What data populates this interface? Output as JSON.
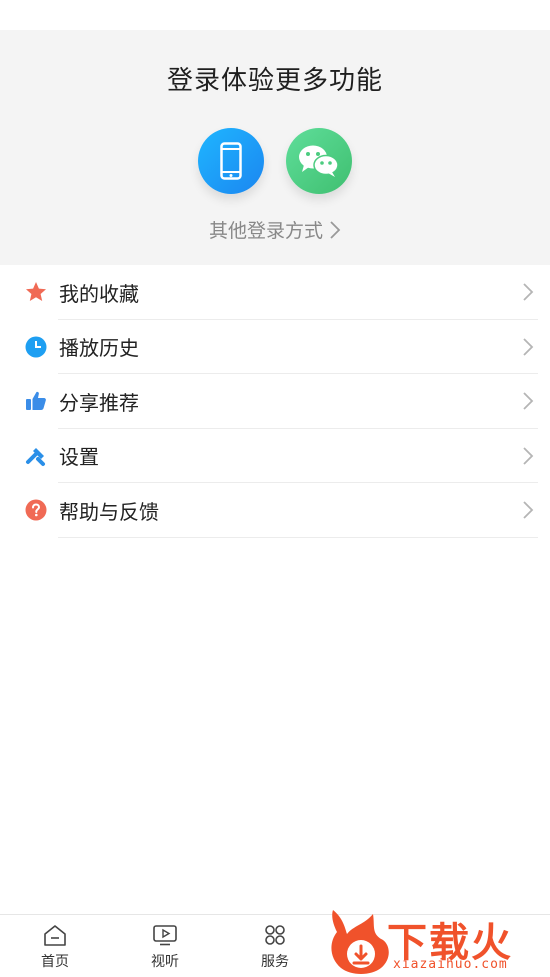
{
  "login": {
    "title": "登录体验更多功能",
    "phone_icon": "phone-icon",
    "wechat_icon": "wechat-icon",
    "other_login_label": "其他登录方式",
    "phone_color": "#1b9cf7",
    "wechat_color": "#4ccc80"
  },
  "menu": {
    "items": [
      {
        "label": "我的收藏",
        "icon": "star-icon",
        "color": "#f06a55"
      },
      {
        "label": "播放历史",
        "icon": "clock-icon",
        "color": "#1e9ff2"
      },
      {
        "label": "分享推荐",
        "icon": "thumbs-up-icon",
        "color": "#3b8de8"
      },
      {
        "label": "设置",
        "icon": "wrench-icon",
        "color": "#2a8fe8"
      },
      {
        "label": "帮助与反馈",
        "icon": "help-icon",
        "color": "#f06a55"
      }
    ]
  },
  "tabbar": {
    "items": [
      {
        "label": "首页",
        "icon": "home-icon"
      },
      {
        "label": "视听",
        "icon": "video-icon"
      },
      {
        "label": "服务",
        "icon": "services-icon"
      }
    ]
  },
  "watermark": {
    "brand": "下载火",
    "domain": "xiazaihuo.com",
    "color": "#f0522b"
  }
}
